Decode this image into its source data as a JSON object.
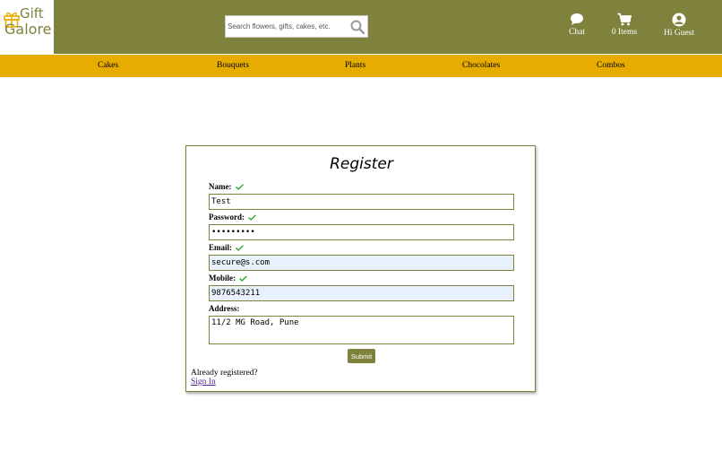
{
  "header": {
    "logo": {
      "line1": "Gift",
      "line2": "Galore",
      "icon": "gift-icon"
    },
    "search": {
      "placeholder": "Search flowers, gifts, cakes, etc.",
      "value": "",
      "icon": "search-icon"
    },
    "chat_label": "Chat",
    "cart_label": "0 Items",
    "user_label": "Hi Guest"
  },
  "nav": {
    "items": [
      "Cakes",
      "Bouquets",
      "Plants",
      "Chocolates",
      "Combos"
    ]
  },
  "form": {
    "title": "Register",
    "name_label": "Name:",
    "name_value": "Test",
    "password_label": "Password:",
    "password_value": "secret123",
    "email_label": "Email:",
    "email_value": "secure@s.com",
    "mobile_label": "Mobile:",
    "mobile_value": "9876543211",
    "address_label": "Address:",
    "address_value": "11/2 MG Road, Pune",
    "submit_label": "Submit",
    "already_text": "Already registered?",
    "signin_label": "Sign In"
  },
  "colors": {
    "brand": "#7f823c",
    "nav": "#e6ad00",
    "valid": "#2e9e2e"
  }
}
